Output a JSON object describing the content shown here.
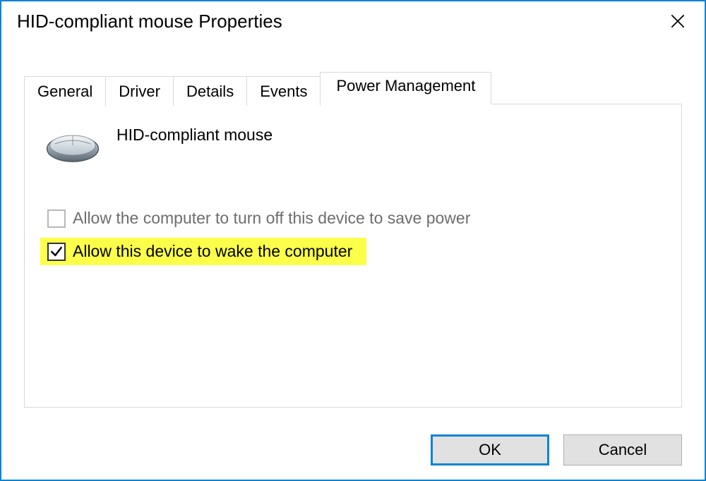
{
  "window": {
    "title": "HID-compliant mouse Properties"
  },
  "tabs": {
    "general": "General",
    "driver": "Driver",
    "details": "Details",
    "events": "Events",
    "power": "Power Management"
  },
  "device": {
    "name": "HID-compliant mouse"
  },
  "options": {
    "turn_off": {
      "label": "Allow the computer to turn off this device to save power",
      "checked": false,
      "enabled": false
    },
    "wake": {
      "label": "Allow this device to wake the computer",
      "checked": true,
      "enabled": true,
      "highlighted": true
    }
  },
  "buttons": {
    "ok": "OK",
    "cancel": "Cancel"
  }
}
